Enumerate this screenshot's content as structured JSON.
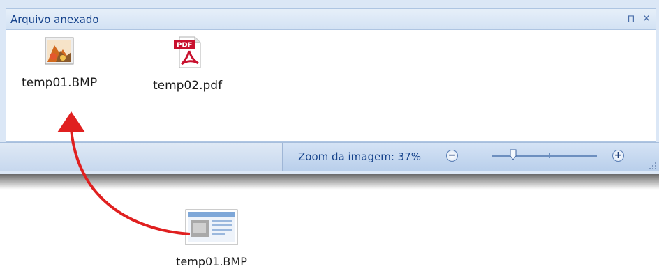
{
  "panel": {
    "title": "Arquivo anexado",
    "pin_glyph": "⊓",
    "close_glyph": "✕"
  },
  "files": [
    {
      "name": "temp01.BMP",
      "icon": "bmp-image-icon"
    },
    {
      "name": "temp02.pdf",
      "icon": "pdf-file-icon",
      "badge": "PDF"
    }
  ],
  "statusbar": {
    "zoom_label": "Zoom da imagem: 37%",
    "zoom_percent": 37,
    "zoom_out_glyph": "−",
    "zoom_in_glyph": "+"
  },
  "dragged_file": {
    "name": "temp01.BMP",
    "icon": "bmp-thumbnail-icon"
  },
  "colors": {
    "title_text": "#15428b",
    "arrow": "#e02020",
    "pdf_red": "#c8102e"
  }
}
